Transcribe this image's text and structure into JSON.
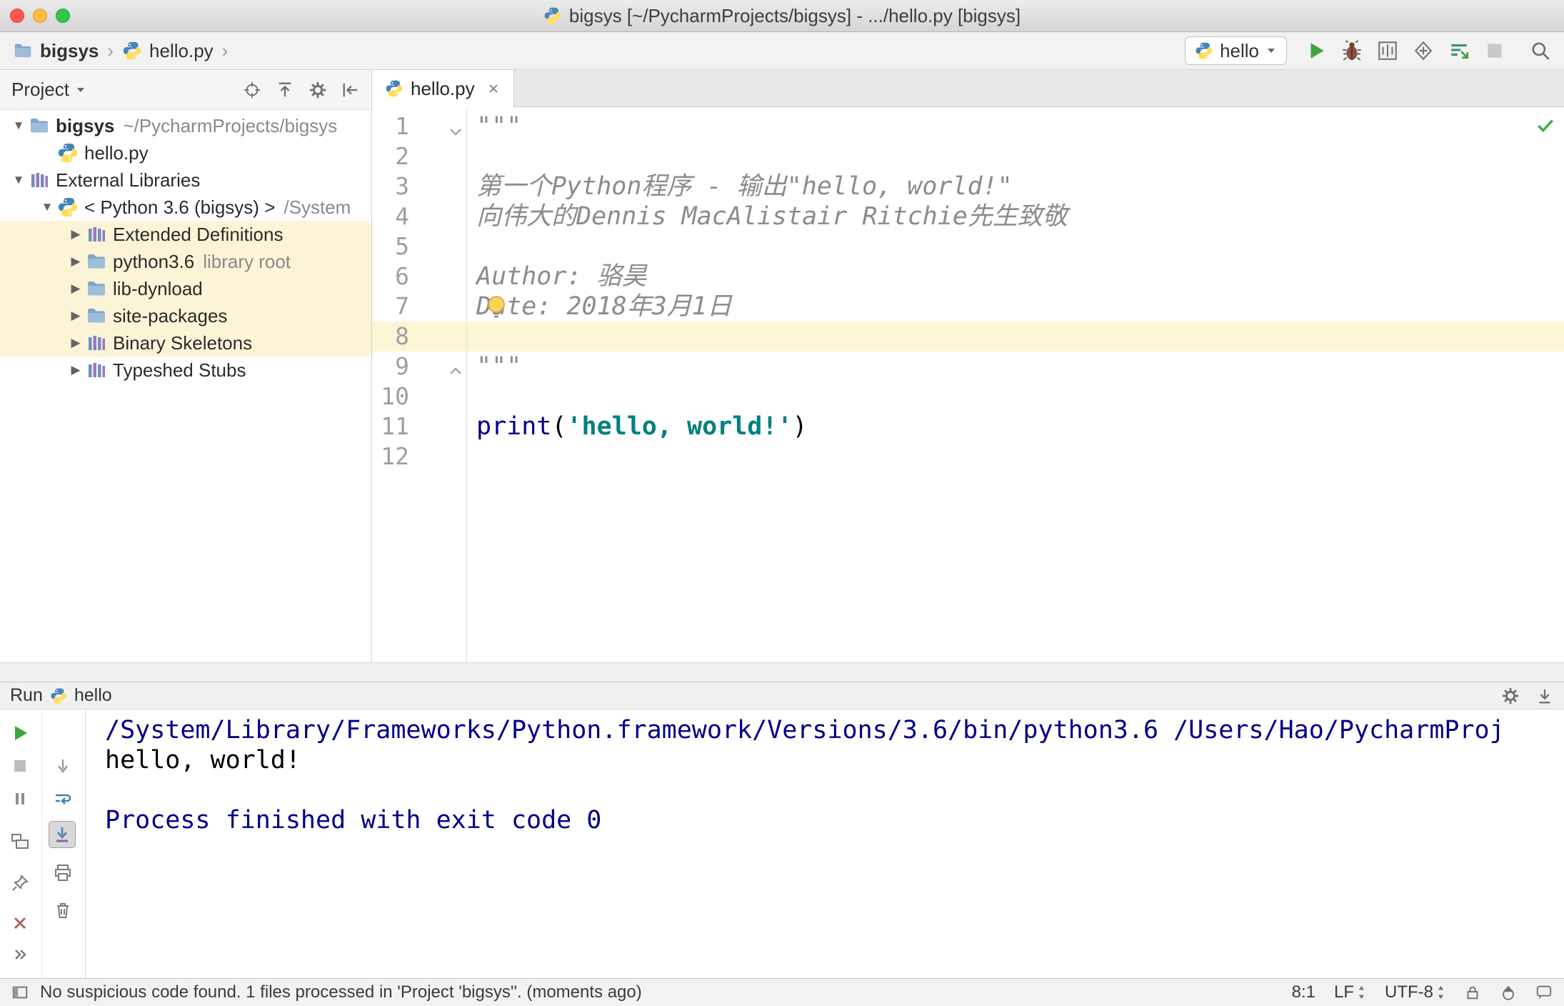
{
  "colors": {
    "accent_green": "#3fa33f",
    "keyword": "#000080",
    "string": "#008080",
    "comment": "#8c8c8c",
    "system_output": "#000087",
    "current_line_highlight": "#fcf6d6",
    "library_row_highlight": "#fbf4d7"
  },
  "titlebar": {
    "title": "bigsys [~/PycharmProjects/bigsys] - .../hello.py [bigsys]"
  },
  "navbar": {
    "breadcrumbs": [
      {
        "label": "bigsys",
        "icon": "folder",
        "bold": true
      },
      {
        "label": "hello.py",
        "icon": "python",
        "bold": false
      }
    ],
    "run_config": {
      "label": "hello"
    }
  },
  "project": {
    "header": {
      "title": "Project"
    },
    "tree": [
      {
        "indent": 0,
        "caret": "down",
        "icon": "folder",
        "label": "bigsys",
        "bold": true,
        "suffix": "~/PycharmProjects/bigsys",
        "highlight": false
      },
      {
        "indent": 1,
        "caret": null,
        "icon": "python",
        "label": "hello.py",
        "bold": false,
        "suffix": "",
        "highlight": false
      },
      {
        "indent": 0,
        "caret": "down",
        "icon": "library",
        "label": "External Libraries",
        "bold": false,
        "suffix": "",
        "highlight": false
      },
      {
        "indent": 1,
        "caret": "down",
        "icon": "python",
        "label": "< Python 3.6 (bigsys) >",
        "bold": false,
        "suffix": "/System",
        "highlight": false
      },
      {
        "indent": 2,
        "caret": "right",
        "icon": "library",
        "label": "Extended Definitions",
        "bold": false,
        "suffix": "",
        "highlight": true
      },
      {
        "indent": 2,
        "caret": "right",
        "icon": "folder",
        "label": "python3.6",
        "bold": false,
        "suffix": "library root",
        "highlight": true
      },
      {
        "indent": 2,
        "caret": "right",
        "icon": "folder",
        "label": "lib-dynload",
        "bold": false,
        "suffix": "",
        "highlight": true
      },
      {
        "indent": 2,
        "caret": "right",
        "icon": "folder",
        "label": "site-packages",
        "bold": false,
        "suffix": "",
        "highlight": true
      },
      {
        "indent": 2,
        "caret": "right",
        "icon": "library",
        "label": "Binary Skeletons",
        "bold": false,
        "suffix": "",
        "highlight": true
      },
      {
        "indent": 2,
        "caret": "right",
        "icon": "library",
        "label": "Typeshed Stubs",
        "bold": false,
        "suffix": "",
        "highlight": false
      }
    ]
  },
  "editor": {
    "tab": {
      "label": "hello.py"
    },
    "current_line": 8,
    "lines": [
      {
        "n": 1,
        "fold": "top",
        "current": false,
        "segs": [
          {
            "t": "\"\"\"",
            "c": "com"
          }
        ]
      },
      {
        "n": 2,
        "current": false,
        "segs": []
      },
      {
        "n": 3,
        "current": false,
        "segs": [
          {
            "t": "第一个Python程序 - 输出\"hello, world!\"",
            "c": "com"
          }
        ]
      },
      {
        "n": 4,
        "current": false,
        "segs": [
          {
            "t": "向伟大的Dennis MacAlistair Ritchie先生致敬",
            "c": "com"
          }
        ]
      },
      {
        "n": 5,
        "current": false,
        "segs": []
      },
      {
        "n": 6,
        "current": false,
        "segs": [
          {
            "t": "Author: 骆昊",
            "c": "com"
          }
        ]
      },
      {
        "n": 7,
        "current": false,
        "segs": [
          {
            "t": "Date: 2018年3月1日",
            "c": "com"
          }
        ]
      },
      {
        "n": 8,
        "current": true,
        "segs": []
      },
      {
        "n": 9,
        "fold": "bottom",
        "current": false,
        "segs": [
          {
            "t": "\"\"\"",
            "c": "com"
          }
        ]
      },
      {
        "n": 10,
        "current": false,
        "segs": []
      },
      {
        "n": 11,
        "current": false,
        "segs": [
          {
            "t": "print",
            "c": "kw"
          },
          {
            "t": "(",
            "c": "pln"
          },
          {
            "t": "'hello, world!'",
            "c": "str"
          },
          {
            "t": ")",
            "c": "pln"
          }
        ]
      },
      {
        "n": 12,
        "current": false,
        "segs": []
      }
    ]
  },
  "run": {
    "header": {
      "label": "Run",
      "config": "hello"
    },
    "console": [
      {
        "type": "system",
        "text": "/System/Library/Frameworks/Python.framework/Versions/3.6/bin/python3.6 /Users/Hao/PycharmProj"
      },
      {
        "type": "stdout",
        "text": "hello, world!"
      },
      {
        "type": "stdout",
        "text": ""
      },
      {
        "type": "system",
        "text": "Process finished with exit code 0"
      }
    ]
  },
  "statusbar": {
    "message": "No suspicious code found. 1 files processed in 'Project 'bigsys''. (moments ago)",
    "position": "8:1",
    "line_separator": "LF",
    "encoding": "UTF-8"
  }
}
